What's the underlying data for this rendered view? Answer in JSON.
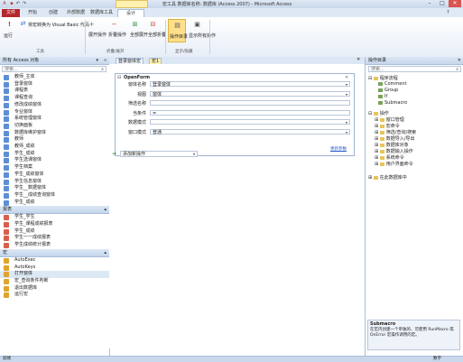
{
  "titlebar": {
    "title": "宏工具  数据库名称: 数据库 (Access 2007) - Microsoft Access",
    "context_tab": "宏工具",
    "minimize": "–",
    "maximize": "□",
    "close": "✕"
  },
  "tabs": [
    "文件",
    "开始",
    "创建",
    "外部数据",
    "数据库工具",
    "设计"
  ],
  "ribbon": {
    "run_label": "运行",
    "tools_label": "将宏转换为 Visual Basic 代码",
    "expand_label": "展开操作",
    "collapse_label": "折叠操作",
    "expand_all_label": "全部展开",
    "collapse_all_label": "全部折叠",
    "catalog_label": "操作目录",
    "show_all_label": "显示所有操作",
    "group_tools": "工具",
    "group_expand": "折叠/展开",
    "group_showhide": "显示/隐藏"
  },
  "nav": {
    "header": "所有 Access 对象",
    "search_placeholder": "搜索...",
    "sections": [
      {
        "title": "窗体",
        "items": [
          {
            "label": "教师_主体",
            "icon": "form-icon"
          },
          {
            "label": "登录窗体",
            "icon": "form-icon"
          },
          {
            "label": "课程表",
            "icon": "form-icon"
          },
          {
            "label": "课程查询",
            "icon": "form-icon"
          },
          {
            "label": "修改成绩窗体",
            "icon": "form-icon"
          },
          {
            "label": "专业窗体",
            "icon": "form-icon"
          },
          {
            "label": "系统管理窗体",
            "icon": "form-icon"
          },
          {
            "label": "切换面板",
            "icon": "form-icon"
          },
          {
            "label": "数据库维护窗体",
            "icon": "form-icon"
          },
          {
            "label": "教师",
            "icon": "form-icon"
          },
          {
            "label": "教师_成绩",
            "icon": "form-icon"
          },
          {
            "label": "学生_成绩",
            "icon": "form-icon"
          },
          {
            "label": "学生选课窗体",
            "icon": "form-icon"
          },
          {
            "label": "学生档案",
            "icon": "form-icon"
          },
          {
            "label": "学生_成绩窗体",
            "icon": "form-icon"
          },
          {
            "label": "学生信息窗体",
            "icon": "form-icon"
          },
          {
            "label": "学生__数据窗体",
            "icon": "form-icon"
          },
          {
            "label": "学生__成绩查询窗体",
            "icon": "form-icon"
          },
          {
            "label": "学生_成绩",
            "icon": "form-icon"
          }
        ]
      },
      {
        "title": "报表",
        "items": [
          {
            "label": "学生_学生",
            "icon": "report-icon"
          },
          {
            "label": "学生_课程成绩报表",
            "icon": "report-icon"
          },
          {
            "label": "学生_成绩",
            "icon": "report-icon"
          },
          {
            "label": "学生一一成绩报表",
            "icon": "report-icon"
          },
          {
            "label": "学生成绩统计报表",
            "icon": "report-icon"
          }
        ]
      },
      {
        "title": "宏",
        "items": [
          {
            "label": "AutoExec",
            "icon": "macro-icon"
          },
          {
            "label": "AutoKeys",
            "icon": "macro-icon"
          },
          {
            "label": "打开窗体",
            "icon": "macro-icon",
            "selected": true
          },
          {
            "label": "宏_查询条件判断",
            "icon": "macro-icon"
          },
          {
            "label": "退出数据库",
            "icon": "macro-icon"
          },
          {
            "label": "运行宏",
            "icon": "macro-icon"
          }
        ]
      }
    ]
  },
  "doctabs": [
    "登录窗体宏",
    "宏1"
  ],
  "action": {
    "name": "OpenForm",
    "args": [
      {
        "label": "窗体名称",
        "value": "登录窗体",
        "has_dropdown": true
      },
      {
        "label": "视图",
        "value": "窗体",
        "has_dropdown": true
      },
      {
        "label": "筛选名称",
        "value": "",
        "has_dropdown": false
      },
      {
        "label": "当条件",
        "value": "=",
        "has_dropdown": false
      },
      {
        "label": "数据模式",
        "value": "",
        "has_dropdown": true
      },
      {
        "label": "窗口模式",
        "value": "普通",
        "has_dropdown": true
      }
    ],
    "update_link": "更新参数",
    "add_new": "添加新操作"
  },
  "catalog": {
    "header": "操作目录",
    "search_placeholder": "搜索...",
    "flow_title": "程序流程",
    "flow_items": [
      "Comment",
      "Group",
      "If",
      "Submacro"
    ],
    "actions_title": "操作",
    "action_folders": [
      "窗口管理",
      "宏命令",
      "筛选/查询/搜索",
      "数据导入/导出",
      "数据库对象",
      "数据输入操作",
      "系统命令",
      "用户界面命令"
    ],
    "db_title": "在此数据库中",
    "desc_title": "Submacro",
    "desc_text": "在宏内创建一个单独的、可使用 RunMacro 或 OnError 宏操作调用的宏。"
  },
  "status": {
    "left": "就绪",
    "right": "数字"
  },
  "colors": {
    "accent": "#b5272d",
    "ribbon_blue": "#c9d7ea",
    "context_yellow": "#fff2b0"
  }
}
